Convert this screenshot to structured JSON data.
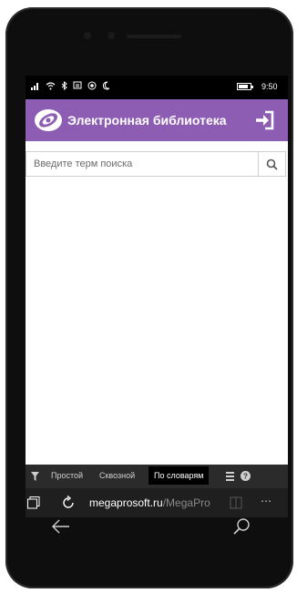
{
  "status_bar": {
    "time": "9:50",
    "battery_level": 0.85
  },
  "app_bar": {
    "title": "Электронная библиотека",
    "logo_icon": "eye-logo-icon",
    "login_icon": "login-arrow-icon",
    "color": "#8d5cb3"
  },
  "search": {
    "placeholder": "Введите терм поиска",
    "value": "",
    "button_icon": "search-icon"
  },
  "footer": {
    "filter_icon": "filter-icon",
    "modes": [
      "Простой",
      "Сквозной",
      "По словарям"
    ],
    "active_mode": "По словарям",
    "list_icon": "list-icon",
    "help_icon": "help-icon"
  },
  "browser": {
    "url_domain": "megaprosoft.ru",
    "url_path": "/MegaPro",
    "tabs_icon": "tabs-icon",
    "refresh_icon": "refresh-icon",
    "reading_icon": "reading-view-icon",
    "more_icon": "more-icon"
  },
  "nav": {
    "back_icon": "back-arrow-icon",
    "search_icon": "search-icon"
  }
}
